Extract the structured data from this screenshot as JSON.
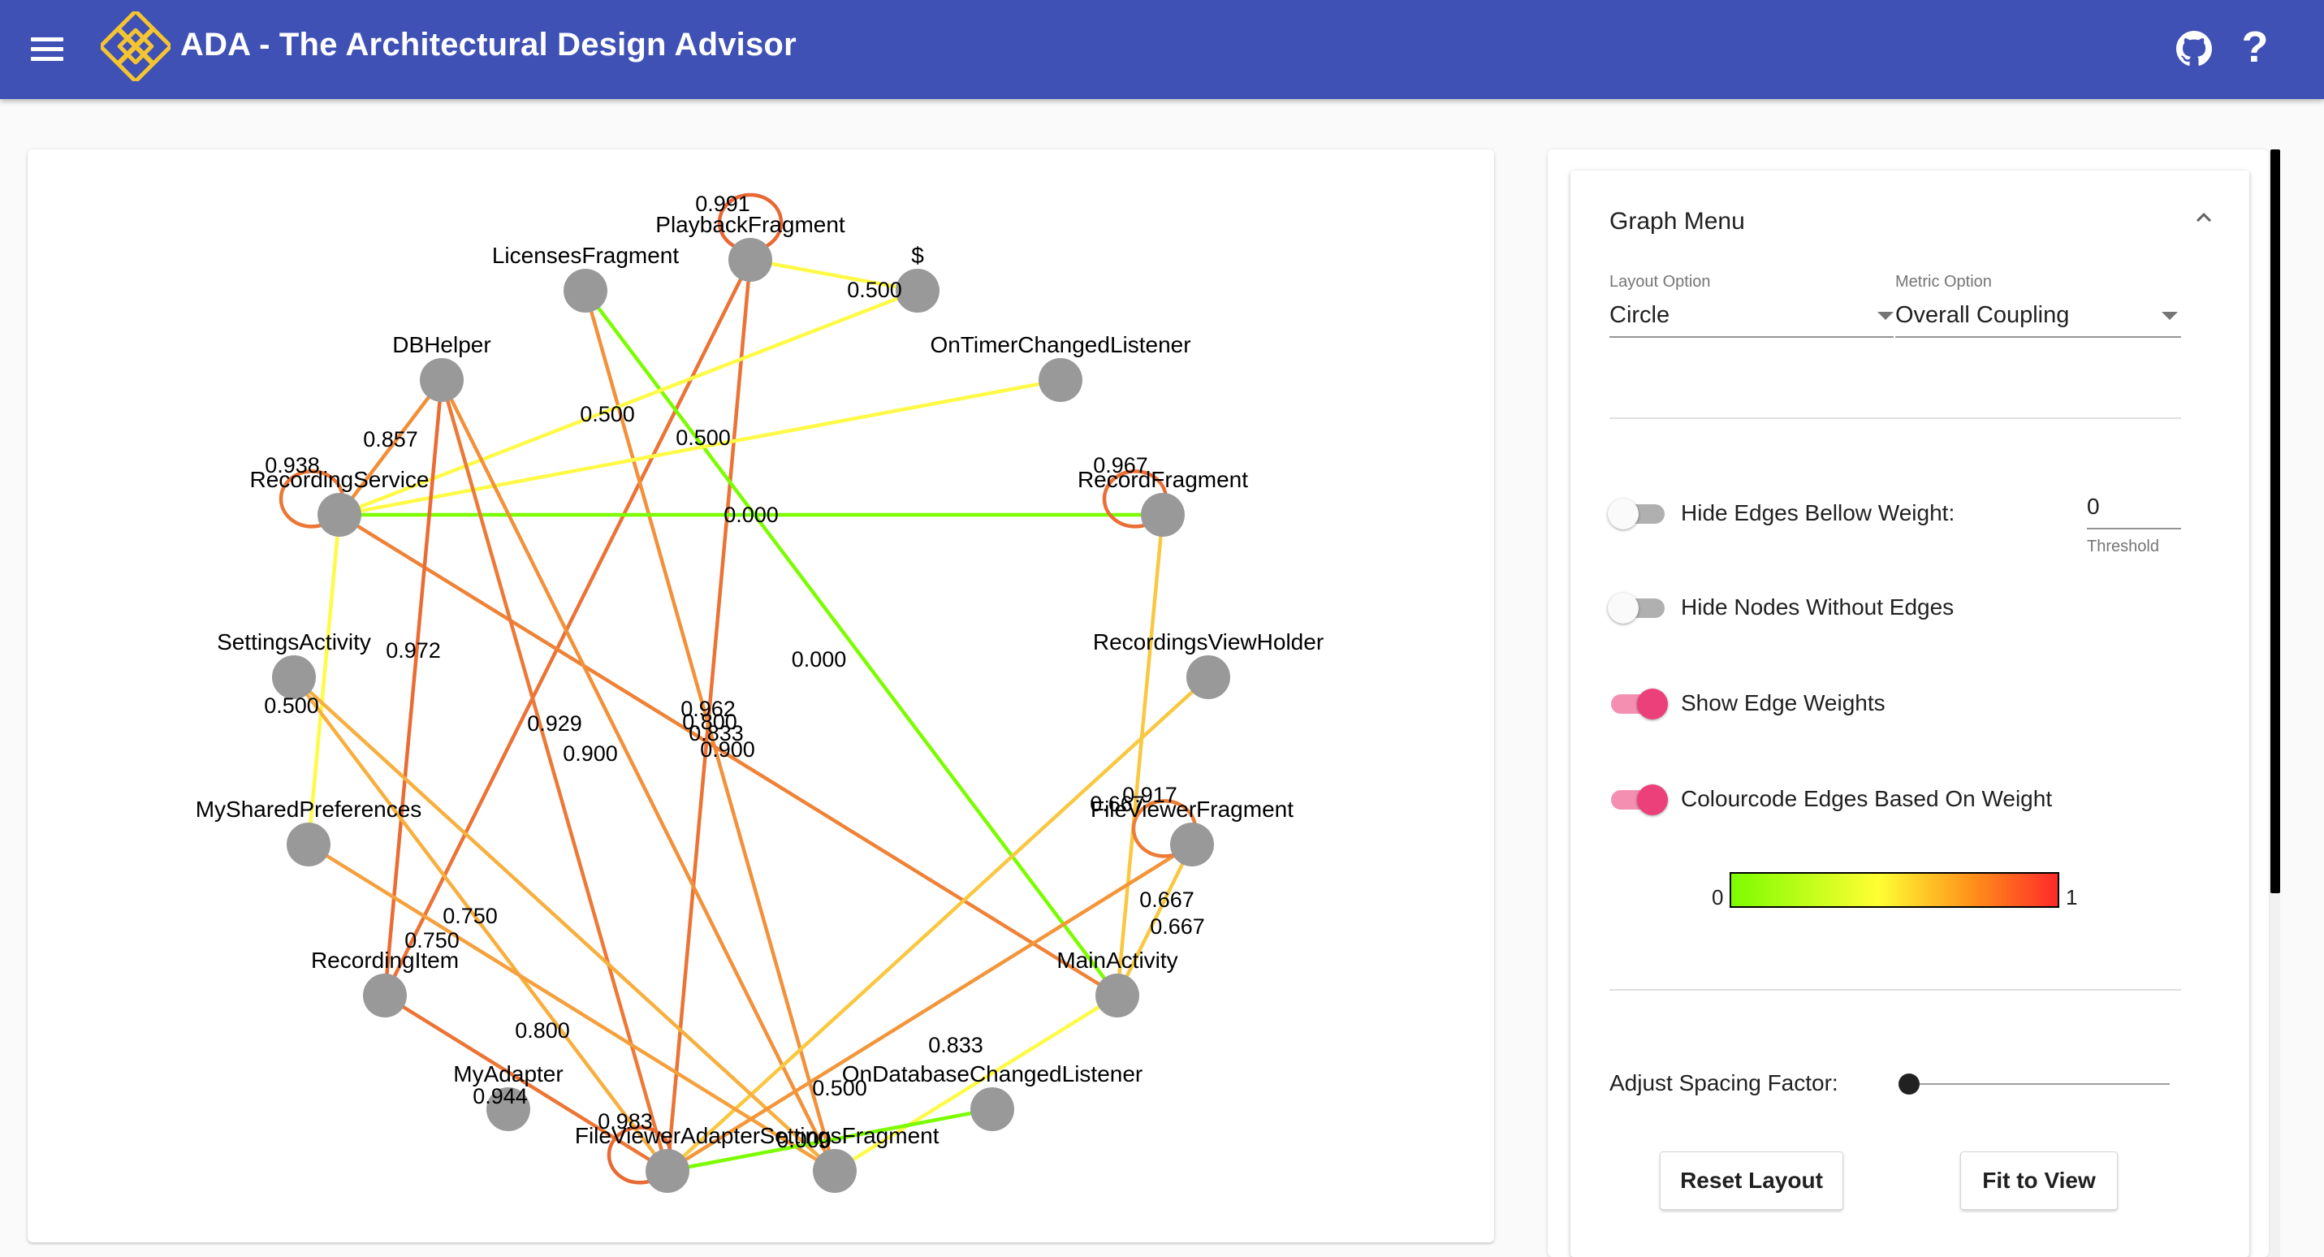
{
  "app": {
    "title": "ADA - The Architectural Design Advisor"
  },
  "icons": {
    "menu": "hamburger-menu-icon",
    "logo": "ada-knot-logo",
    "github": "github-icon",
    "help": "help-question-icon",
    "help_glyph": "?",
    "collapse": "chevron-up-icon"
  },
  "colors": {
    "appbar": "#3f51b5",
    "node": "#999999",
    "toggle_on": "#ec407a",
    "toggle_on_track": "#f48fb1",
    "scale_low": "#7cfc00",
    "scale_mid": "#ffff33",
    "scale_high": "#ff2a2a"
  },
  "graph": {
    "nodes": [
      {
        "id": "licenses",
        "label": "LicensesFragment"
      },
      {
        "id": "playback",
        "label": "PlaybackFragment"
      },
      {
        "id": "dollar",
        "label": "$"
      },
      {
        "id": "dbhelper",
        "label": "DBHelper"
      },
      {
        "id": "ontimer",
        "label": "OnTimerChangedListener"
      },
      {
        "id": "recsvc",
        "label": "RecordingService"
      },
      {
        "id": "recfrag",
        "label": "RecordFragment"
      },
      {
        "id": "settact",
        "label": "SettingsActivity"
      },
      {
        "id": "rvh",
        "label": "RecordingsViewHolder"
      },
      {
        "id": "mysp",
        "label": "MySharedPreferences"
      },
      {
        "id": "fvfrag",
        "label": "FileViewerFragment"
      },
      {
        "id": "recitem",
        "label": "RecordingItem"
      },
      {
        "id": "mainact",
        "label": "MainActivity"
      },
      {
        "id": "myadapter",
        "label": "MyAdapter"
      },
      {
        "id": "ondb",
        "label": "OnDatabaseChangedListener"
      },
      {
        "id": "fvadapter",
        "label": "FileViewerAdapter"
      },
      {
        "id": "settfrag",
        "label": "SettingsFragment"
      }
    ],
    "edges": [
      {
        "from": "playback",
        "to": "dollar",
        "weight": "0.500"
      },
      {
        "from": "playback",
        "to": "recitem",
        "weight": ""
      },
      {
        "from": "playback",
        "to": "fvadapter",
        "weight": ""
      },
      {
        "from": "licenses",
        "to": "mainact",
        "weight": "0.000"
      },
      {
        "from": "licenses",
        "to": "settfrag",
        "weight": ""
      },
      {
        "from": "dollar",
        "to": "recsvc",
        "weight": "0.500"
      },
      {
        "from": "ontimer",
        "to": "recsvc",
        "weight": "0.500"
      },
      {
        "from": "recsvc",
        "to": "dbhelper",
        "weight": "0.857"
      },
      {
        "from": "recsvc",
        "to": "recfrag",
        "weight": "0.000"
      },
      {
        "from": "recsvc",
        "to": "mainact",
        "weight": "0.900"
      },
      {
        "from": "recsvc",
        "to": "mysp",
        "weight": "0.500"
      },
      {
        "from": "dbhelper",
        "to": "recitem",
        "weight": "0.972"
      },
      {
        "from": "dbhelper",
        "to": "fvadapter",
        "weight": "0.929"
      },
      {
        "from": "dbhelper",
        "to": "settfrag",
        "weight": ""
      },
      {
        "from": "recfrag",
        "to": "mainact",
        "weight": "0.667"
      },
      {
        "from": "rvh",
        "to": "fvadapter",
        "weight": "0.667"
      },
      {
        "from": "settact",
        "to": "fvadapter",
        "weight": "0.750"
      },
      {
        "from": "settact",
        "to": "settfrag",
        "weight": "0.750"
      },
      {
        "from": "mysp",
        "to": "settfrag",
        "weight": "0.800"
      },
      {
        "from": "fvfrag",
        "to": "fvadapter",
        "weight": "0.833"
      },
      {
        "from": "fvfrag",
        "to": "mainact",
        "weight": "0.667"
      },
      {
        "from": "mainact",
        "to": "settfrag",
        "weight": "0.500"
      },
      {
        "from": "recitem",
        "to": "fvadapter",
        "weight": "0.944"
      },
      {
        "from": "ondb",
        "to": "fvadapter",
        "weight": "0.000"
      }
    ],
    "self_loops": [
      {
        "node": "playback",
        "weight": "0.991"
      },
      {
        "node": "recsvc",
        "weight": "0.938"
      },
      {
        "node": "recfrag",
        "weight": "0.967"
      },
      {
        "node": "fvfrag",
        "weight": "0.917"
      },
      {
        "node": "fvadapter",
        "weight": "0.983"
      }
    ],
    "center_labels": [
      "0.962",
      "0.800",
      "0.833",
      "0.900"
    ]
  },
  "graph_menu": {
    "title": "Graph Menu",
    "layout_option": {
      "label": "Layout Option",
      "value": "Circle"
    },
    "metric_option": {
      "label": "Metric Option",
      "value": "Overall Coupling"
    },
    "hide_edges": {
      "label": "Hide Edges Bellow Weight:",
      "enabled": false
    },
    "threshold": {
      "value": "0",
      "helper": "Threshold"
    },
    "hide_nodes": {
      "label": "Hide Nodes Without Edges",
      "enabled": false
    },
    "show_weights": {
      "label": "Show Edge Weights",
      "enabled": true
    },
    "colourcode": {
      "label": "Colourcode Edges Based On Weight",
      "enabled": true
    },
    "scale": {
      "min": "0",
      "max": "1"
    },
    "spacing": {
      "label": "Adjust Spacing Factor:",
      "value": 0
    },
    "reset_button": "Reset Layout",
    "fit_button": "Fit to View"
  }
}
